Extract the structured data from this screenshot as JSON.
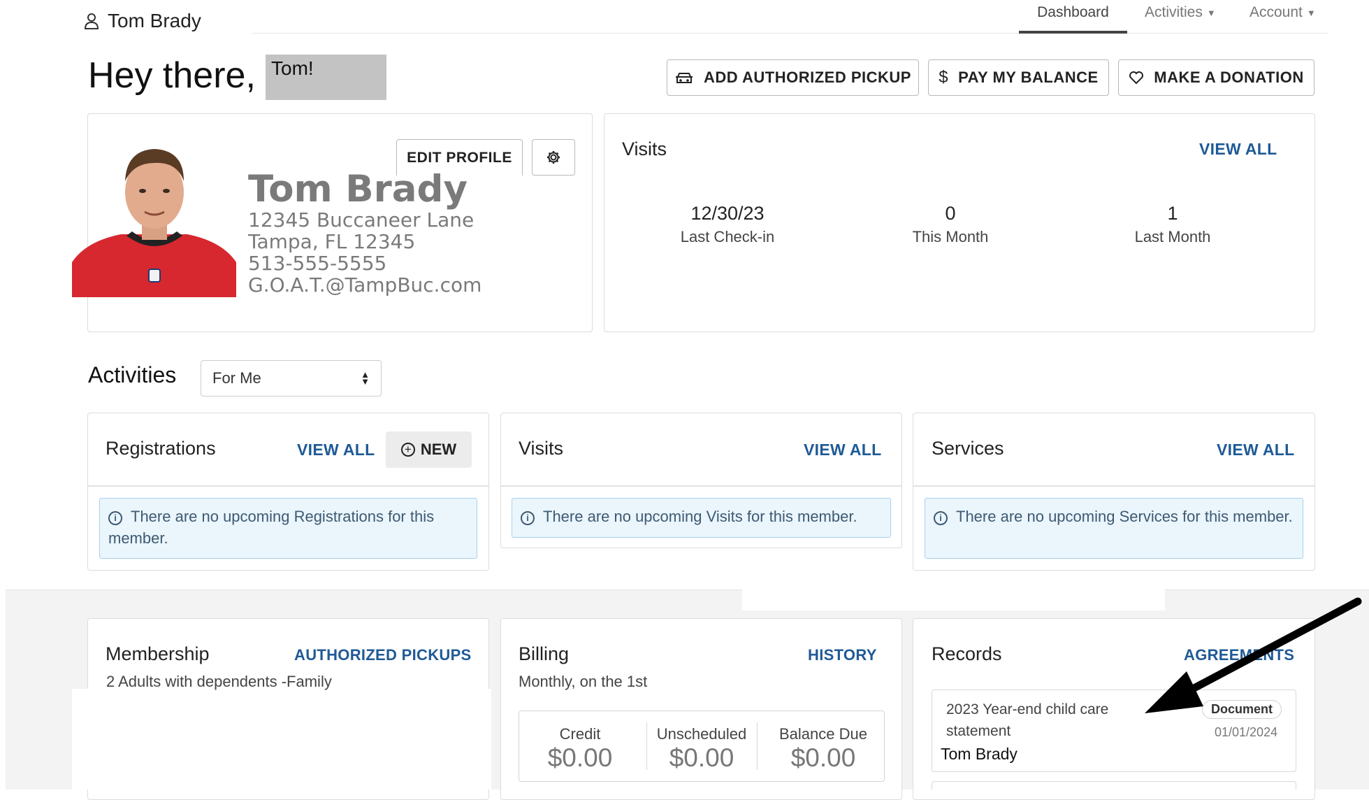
{
  "header": {
    "user_name": "Tom Brady",
    "nav": [
      {
        "label": "Dashboard",
        "active": true
      },
      {
        "label": "Activities",
        "dropdown": true
      },
      {
        "label": "Account",
        "dropdown": true
      }
    ]
  },
  "greeting": {
    "prefix": "Hey there,",
    "name": "Tom!"
  },
  "actions": {
    "add_pickup": "ADD AUTHORIZED PICKUP",
    "pay_balance": "PAY MY BALANCE",
    "donate": "MAKE A DONATION"
  },
  "profile": {
    "edit_label": "EDIT PROFILE",
    "name": "Tom Brady",
    "address1": "12345 Buccaneer Lane",
    "address2": "Tampa, FL 12345",
    "phone": "513-555-5555",
    "email": "G.O.A.T.@TampBuc.com"
  },
  "visits_card": {
    "title": "Visits",
    "view_all": "VIEW ALL",
    "stats": [
      {
        "value": "12/30/23",
        "label": "Last Check-in"
      },
      {
        "value": "0",
        "label": "This Month"
      },
      {
        "value": "1",
        "label": "Last Month"
      }
    ]
  },
  "activities": {
    "title": "Activities",
    "filter_value": "For Me",
    "registrations": {
      "title": "Registrations",
      "view_all": "VIEW ALL",
      "new_label": "NEW",
      "message": "There are no upcoming Registrations for this member."
    },
    "visits": {
      "title": "Visits",
      "view_all": "VIEW ALL",
      "message": "There are no upcoming Visits for this member."
    },
    "services": {
      "title": "Services",
      "view_all": "VIEW ALL",
      "message": "There are no upcoming Services for this member."
    }
  },
  "membership": {
    "title": "Membership",
    "link": "AUTHORIZED PICKUPS",
    "plan": "2 Adults with dependents -Family"
  },
  "billing": {
    "title": "Billing",
    "link": "HISTORY",
    "schedule": "Monthly, on the 1st",
    "items": [
      {
        "label": "Credit",
        "value": "$0.00"
      },
      {
        "label": "Unscheduled",
        "value": "$0.00"
      },
      {
        "label": "Balance Due",
        "value": "$0.00"
      }
    ]
  },
  "records": {
    "title": "Records",
    "link": "AGREEMENTS",
    "item": {
      "title": "2023 Year-end child care statement",
      "badge": "Document",
      "date": "01/01/2024",
      "owner": "Tom Brady"
    }
  },
  "colors": {
    "link_blue": "#1f5a96",
    "info_bg": "#eaf5fc",
    "info_border": "#a8d3ee",
    "jersey_red": "#d7282f"
  }
}
